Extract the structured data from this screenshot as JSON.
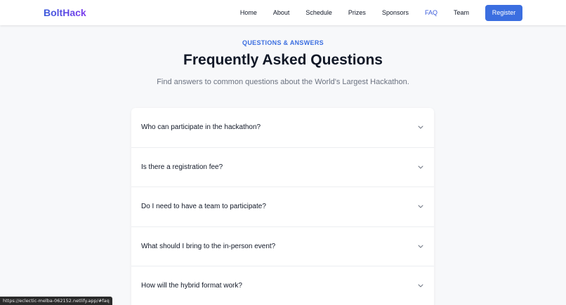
{
  "nav": {
    "logo": "BoltHack",
    "links": [
      {
        "label": "Home",
        "active": false
      },
      {
        "label": "About",
        "active": false
      },
      {
        "label": "Schedule",
        "active": false
      },
      {
        "label": "Prizes",
        "active": false
      },
      {
        "label": "Sponsors",
        "active": false
      },
      {
        "label": "FAQ",
        "active": true
      },
      {
        "label": "Team",
        "active": false
      }
    ],
    "register_label": "Register"
  },
  "hero": {
    "eyebrow": "QUESTIONS & ANSWERS",
    "title": "Frequently Asked Questions",
    "subtitle": "Find answers to common questions about the World's Largest Hackathon."
  },
  "faq": {
    "items": [
      {
        "question": "Who can participate in the hackathon?",
        "icon": "chevron-down-icon"
      },
      {
        "question": "Is there a registration fee?",
        "icon": "chevron-down-icon"
      },
      {
        "question": "Do I need to have a team to participate?",
        "icon": "chevron-down-icon"
      },
      {
        "question": "What should I bring to the in-person event?",
        "icon": "chevron-down-icon"
      },
      {
        "question": "How will the hybrid format work?",
        "icon": "chevron-down-icon"
      }
    ]
  },
  "status_bar": {
    "url": "https://eclectic-melba-062152.netlify.app/#faq"
  },
  "colors": {
    "accent": "#3b6ee0",
    "text": "#111827",
    "muted": "#6b7280",
    "background": "#f7f8fa"
  }
}
